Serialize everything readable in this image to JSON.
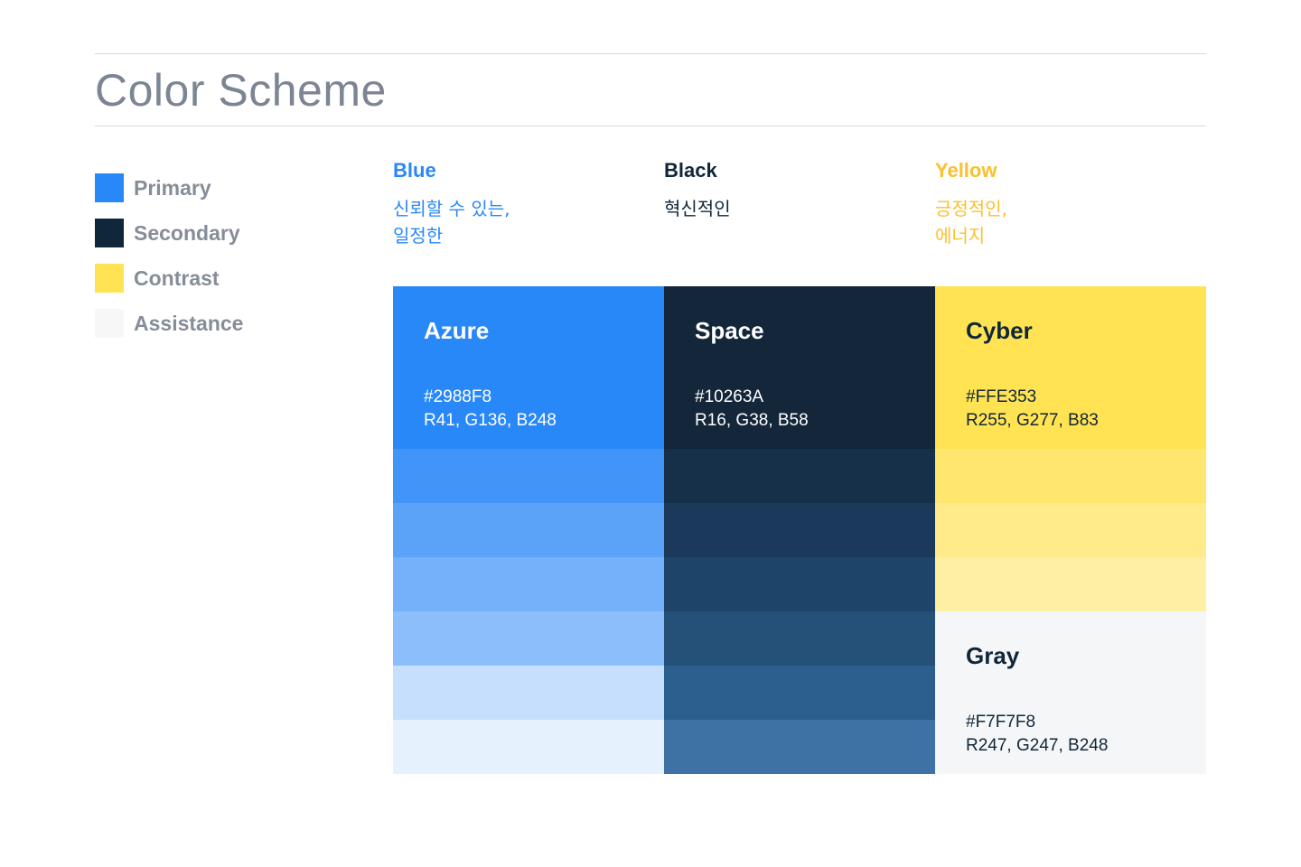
{
  "page": {
    "title": "Color Scheme"
  },
  "legend": [
    {
      "label": "Primary",
      "color": "#2988F8"
    },
    {
      "label": "Secondary",
      "color": "#10263A"
    },
    {
      "label": "Contrast",
      "color": "#FFE353"
    },
    {
      "label": "Assistance",
      "color": "#F7F7F8"
    }
  ],
  "columns": [
    {
      "name": "Blue",
      "desc": "신뢰할 수 있는,\n일정한",
      "color": "#2988F8"
    },
    {
      "name": "Black",
      "desc": "혁신적인",
      "color": "#10263A"
    },
    {
      "name": "Yellow",
      "desc": "긍정적인,\n에너지",
      "color": "#FBC02D"
    }
  ],
  "swatches": {
    "azure": {
      "name": "Azure",
      "hex": "#2988F8",
      "rgb": "R41, G136, B248",
      "color": "#2988F8",
      "text_color": "#FFFFFF",
      "shades": [
        "#4295F8",
        "#5BA3F9",
        "#74B1FA",
        "#8CBEFB",
        "#C5DFFC",
        "#E5F1FD"
      ]
    },
    "space": {
      "name": "Space",
      "hex": "#10263A",
      "rgb": "R16, G38, B58",
      "color": "#13263A",
      "text_color": "#FFFFFF",
      "shades": [
        "#163049",
        "#1B3A5B",
        "#1F446A",
        "#255179",
        "#2C5F8D",
        "#3E72A5"
      ]
    },
    "cyber": {
      "name": "Cyber",
      "hex": "#FFE353",
      "rgb": "R255, G277, B83",
      "color": "#FFE353",
      "text_color": "#10263A",
      "shades": [
        "#FFE66E",
        "#FFEB89",
        "#FFEFA3"
      ]
    },
    "gray": {
      "name": "Gray",
      "hex": "#F7F7F8",
      "rgb": "R247, G247, B248",
      "color": "#F5F6F7",
      "text_color": "#10263A"
    }
  }
}
